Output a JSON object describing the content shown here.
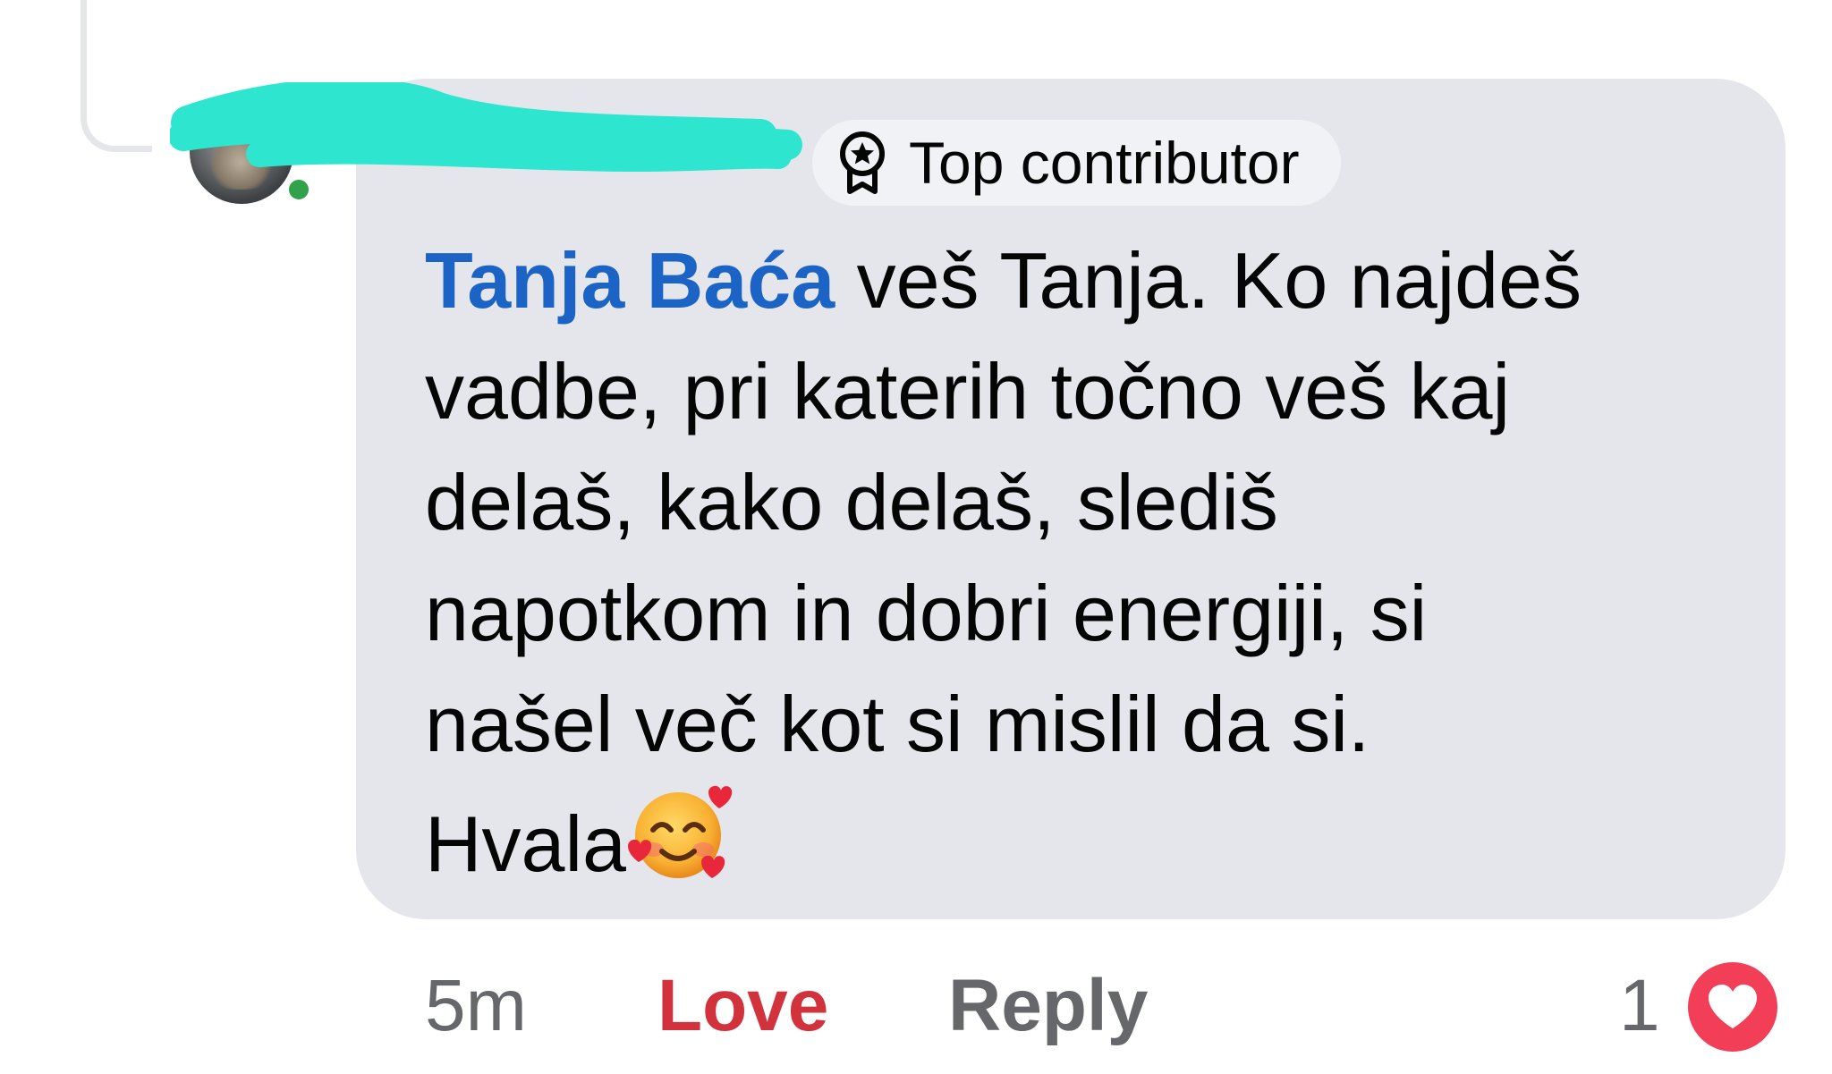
{
  "comment": {
    "author_name": "",
    "badge_label": "Top contributor",
    "badge_icon": "star-badge-icon",
    "mention": "Tanja Baća",
    "text_lines": [
      " veš Tanja. Ko najdeš",
      "vadbe, pri katerih točno veš kaj",
      "delaš, kako delaš, slediš",
      "napotkom in dobri energiji, si",
      "našel več kot si mislil da si.",
      "Hvala"
    ],
    "emoji": "smiling-face-with-hearts",
    "online_status": "online"
  },
  "actions": {
    "time": "5m",
    "love_label": "Love",
    "reply_label": "Reply",
    "reaction_count": "1",
    "reaction_icon": "love-heart-icon"
  },
  "colors": {
    "bubble": "#e4e6eb",
    "mention": "#1b64c6",
    "love": "#d1323b",
    "muted": "#65676b",
    "redaction": "#2ee6cf",
    "reaction_heart": "#f33e58"
  }
}
